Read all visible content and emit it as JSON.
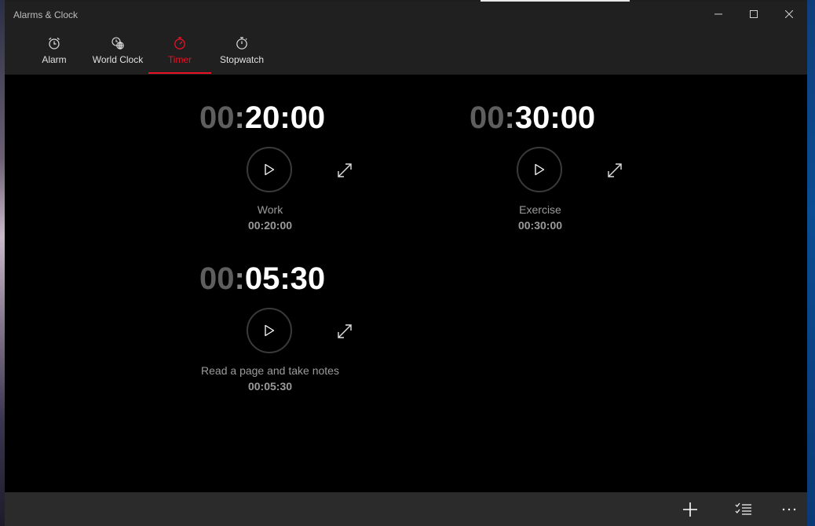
{
  "app": {
    "title": "Alarms & Clock"
  },
  "window_controls": {
    "minimize": "minimize-icon",
    "maximize": "maximize-icon",
    "close": "close-icon"
  },
  "tabs": [
    {
      "label": "Alarm",
      "icon": "alarm-clock-icon",
      "active": false
    },
    {
      "label": "World Clock",
      "icon": "world-clock-icon",
      "active": false
    },
    {
      "label": "Timer",
      "icon": "timer-icon",
      "active": true
    },
    {
      "label": "Stopwatch",
      "icon": "stopwatch-icon",
      "active": false
    }
  ],
  "accent_color": "#e81123",
  "timers": [
    {
      "hours": "00",
      "minutes": "20",
      "seconds": "00",
      "name": "Work",
      "duration": "00:20:00"
    },
    {
      "hours": "00",
      "minutes": "30",
      "seconds": "00",
      "name": "Exercise",
      "duration": "00:30:00"
    },
    {
      "hours": "00",
      "minutes": "05",
      "seconds": "30",
      "name": "Read a page and take notes",
      "duration": "00:05:30"
    }
  ],
  "command_bar": {
    "add": "add-icon",
    "select": "select-list-icon",
    "more": "more-icon"
  }
}
